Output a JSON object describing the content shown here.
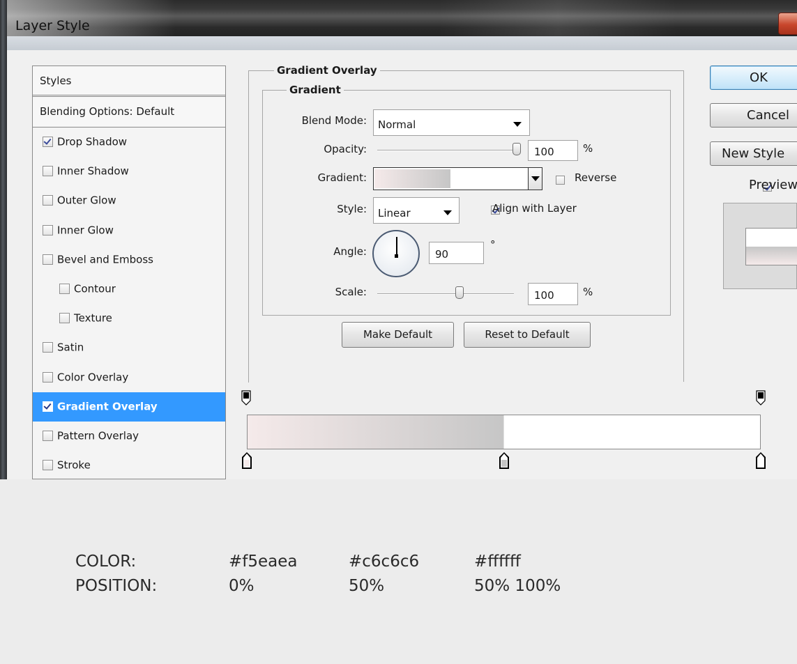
{
  "window": {
    "title": "Layer Style"
  },
  "styles_list": {
    "header": "Styles",
    "blending": "Blending Options: Default",
    "items": [
      {
        "label": "Drop Shadow",
        "checked": true,
        "selected": false,
        "indent": false
      },
      {
        "label": "Inner Shadow",
        "checked": false,
        "selected": false,
        "indent": false
      },
      {
        "label": "Outer Glow",
        "checked": false,
        "selected": false,
        "indent": false
      },
      {
        "label": "Inner Glow",
        "checked": false,
        "selected": false,
        "indent": false
      },
      {
        "label": "Bevel and Emboss",
        "checked": false,
        "selected": false,
        "indent": false
      },
      {
        "label": "Contour",
        "checked": false,
        "selected": false,
        "indent": true
      },
      {
        "label": "Texture",
        "checked": false,
        "selected": false,
        "indent": true
      },
      {
        "label": "Satin",
        "checked": false,
        "selected": false,
        "indent": false
      },
      {
        "label": "Color Overlay",
        "checked": false,
        "selected": false,
        "indent": false
      },
      {
        "label": "Gradient Overlay",
        "checked": true,
        "selected": true,
        "indent": false
      },
      {
        "label": "Pattern Overlay",
        "checked": false,
        "selected": false,
        "indent": false
      },
      {
        "label": "Stroke",
        "checked": false,
        "selected": false,
        "indent": false
      }
    ]
  },
  "panel": {
    "title": "Gradient Overlay",
    "group_title": "Gradient",
    "blend_mode": {
      "label": "Blend Mode:",
      "value": "Normal"
    },
    "opacity": {
      "label": "Opacity:",
      "value": "100",
      "unit": "%",
      "level": 1.0
    },
    "gradient": {
      "label": "Gradient:",
      "reverse_label": "Reverse",
      "reverse_checked": false
    },
    "style": {
      "label": "Style:",
      "value": "Linear",
      "align_label": "Align with Layer",
      "align_checked": true
    },
    "angle": {
      "label": "Angle:",
      "value": "90",
      "unit": "°"
    },
    "scale": {
      "label": "Scale:",
      "value": "100",
      "unit": "%",
      "level": 0.6
    },
    "make_default": "Make Default",
    "reset_default": "Reset to Default"
  },
  "right_buttons": {
    "ok": "OK",
    "cancel": "Cancel",
    "new_style": "New Style",
    "preview_label": "Preview",
    "preview_checked": true
  },
  "gradient_colors": [
    "#f5eaea",
    "#c6c6c6",
    "#ffffff"
  ],
  "info": {
    "color_label": "COLOR:",
    "position_label": "POSITION:",
    "colors": [
      "#f5eaea",
      "#c6c6c6",
      "#ffffff"
    ],
    "positions": [
      "0%",
      "50%",
      "50% 100%"
    ]
  }
}
